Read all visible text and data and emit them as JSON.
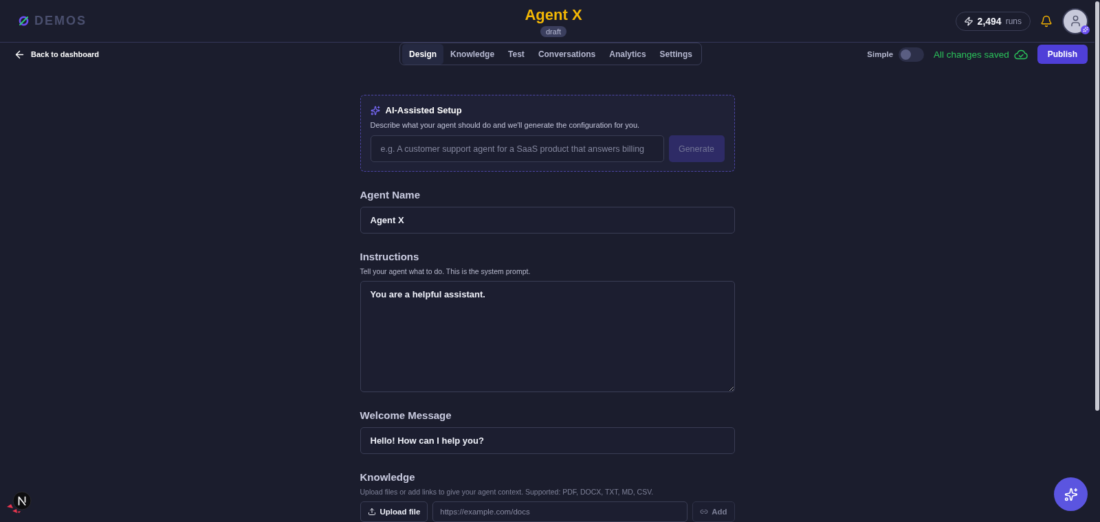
{
  "header": {
    "logo_text": "DEMOS",
    "title": "Agent X",
    "status_badge": "draft",
    "runs": {
      "count": "2,494",
      "unit": "runs"
    }
  },
  "toolbar": {
    "back_link": "Back to dashboard",
    "tabs": [
      {
        "label": "Design",
        "selected": true
      },
      {
        "label": "Knowledge",
        "selected": false
      },
      {
        "label": "Test",
        "selected": false
      },
      {
        "label": "Conversations",
        "selected": false
      },
      {
        "label": "Analytics",
        "selected": false
      },
      {
        "label": "Settings",
        "selected": false
      }
    ],
    "simple_toggle": {
      "label": "Simple",
      "on": false
    },
    "save_status": "All changes saved",
    "publish_button": "Publish"
  },
  "ai_setup": {
    "title": "AI-Assisted Setup",
    "description": "Describe what your agent should do and we'll generate the configuration for you.",
    "prompt": {
      "placeholder": "e.g. A customer support agent for a SaaS product that answers billing"
    },
    "generate_button": {
      "label": "Generate",
      "disabled": true
    }
  },
  "agent_name": {
    "label": "Agent Name",
    "value": "Agent X"
  },
  "instructions": {
    "label": "Instructions",
    "hint": "Tell your agent what to do. This is the system prompt.",
    "value": "You are a helpful assistant."
  },
  "welcome_message": {
    "label": "Welcome Message",
    "value": "Hello! How can I help you?"
  },
  "knowledge": {
    "label": "Knowledge",
    "hint": "Upload files or add links to give your agent context. Supported: PDF, DOCX, TXT, MD, CSV.",
    "upload_button": "Upload file",
    "url_field": {
      "placeholder": "https://example.com/docs"
    },
    "add_button": {
      "label": "Add",
      "disabled": true
    }
  }
}
